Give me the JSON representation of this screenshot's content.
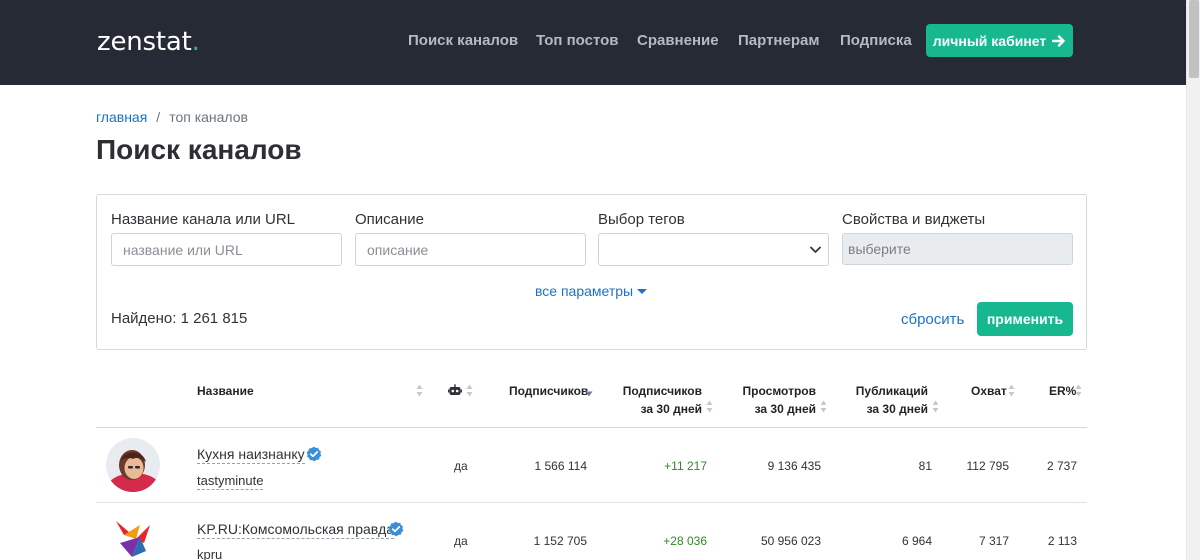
{
  "header": {
    "logo_text": "zenstat",
    "logo_dot": ".",
    "nav": [
      {
        "label": "Поиск каналов"
      },
      {
        "label": "Топ постов"
      },
      {
        "label": "Сравнение"
      },
      {
        "label": "Партнерам"
      },
      {
        "label": "Подписка"
      }
    ],
    "cabinet_label": "личный кабинет",
    "bg_color": "#262a35",
    "accent_color": "#17b890"
  },
  "breadcrumb": {
    "home": "главная",
    "separator": "/",
    "current": "топ каналов"
  },
  "page_title": "Поиск каналов",
  "filter": {
    "name_label": "Название канала или URL",
    "name_placeholder": "название или URL",
    "description_label": "Описание",
    "description_placeholder": "описание",
    "tags_label": "Выбор тегов",
    "tags_value": "",
    "props_label": "Свойства и виджеты",
    "props_placeholder": "выберите",
    "all_params": "все параметры",
    "found_text": "Найдено: 1 261 815",
    "reset_label": "сбросить",
    "apply_label": "применить"
  },
  "table": {
    "columns": {
      "name": "Название",
      "bot_icon": "robot-icon",
      "subscribers": "Подписчиков",
      "subs30_line1": "Подписчиков",
      "subs30_line2": "за 30 дней",
      "views_line1": "Просмотров",
      "views_line2": "за 30 дней",
      "posts_line1": "Публикаций",
      "posts_line2": "за 30 дней",
      "reach": "Охват",
      "er": "ER%"
    },
    "rows": [
      {
        "name": "Кухня наизнанку",
        "handle": "tastyminute",
        "verified": true,
        "bot": "да",
        "subscribers": "1 566 114",
        "subs30": "+11 217",
        "views30": "9 136 435",
        "posts30": "81",
        "reach": "112 795",
        "er": "2 737"
      },
      {
        "name": "KP.RU:Комсомольская правда",
        "handle": "kpru",
        "verified": true,
        "bot": "да",
        "subscribers": "1 152 705",
        "subs30": "+28 036",
        "views30": "50 956 023",
        "posts30": "6 964",
        "reach": "7 317",
        "er": "2 113"
      }
    ]
  }
}
